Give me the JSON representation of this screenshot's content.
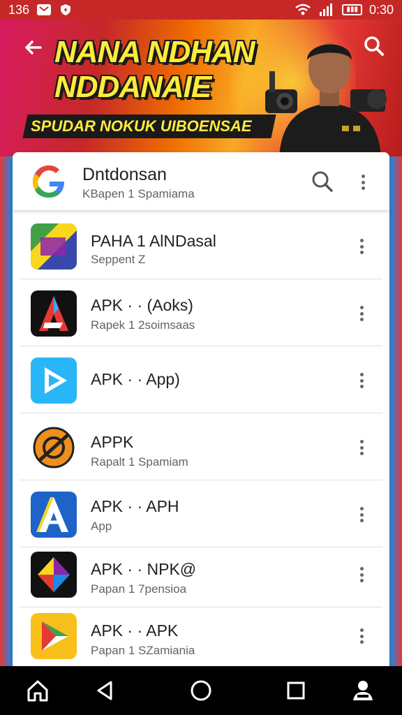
{
  "status_bar": {
    "time_left": "136",
    "time_right": "0:30",
    "icons": [
      "mail-icon",
      "shield-icon",
      "wifi-icon",
      "signal-icon",
      "battery-icon"
    ]
  },
  "banner": {
    "title": "NANA NDHAN NDDANAIE",
    "subtitle": "SPUDAR NOKUK UIBOENSAE"
  },
  "header": {
    "title": "Dntdonsan",
    "subtitle": "KBapen 1 Spamiama"
  },
  "apps": [
    {
      "title": "PAHA 1 AlNDasal",
      "subtitle": "Seppent Z",
      "icon": "colorful-app-icon"
    },
    {
      "title": "APK · · (Aoks)",
      "subtitle": "Rapek 1 2soimsaas",
      "icon": "apk-a-icon"
    },
    {
      "title": "APK · · App)",
      "subtitle": "",
      "icon": "play-icon"
    },
    {
      "title": "APPK",
      "subtitle": "Rapalt 1 Spamiam",
      "icon": "orange-disc-icon"
    },
    {
      "title": "APK · · APH",
      "subtitle": "App",
      "icon": "blue-a-icon"
    },
    {
      "title": "APK · · NPK@",
      "subtitle": "Papan 1 7pensioa",
      "icon": "cube-icon"
    },
    {
      "title": "APK · · APK",
      "subtitle": "Papan 1 SZamiania",
      "icon": "yellow-play-icon"
    }
  ],
  "nav": [
    "home-icon",
    "back-icon",
    "circle-home-icon",
    "recents-icon",
    "person-icon"
  ]
}
